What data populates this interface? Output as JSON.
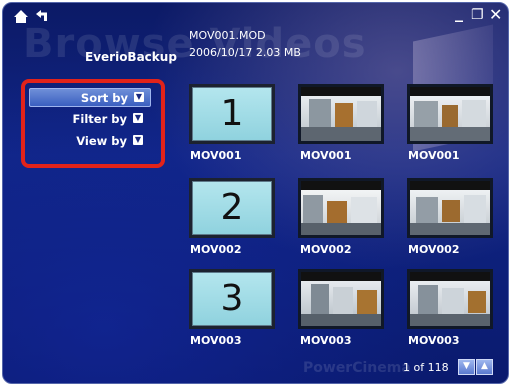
{
  "watermark": "Browse Videos",
  "header": {
    "file_name": "MOV001.MOD",
    "file_info": "2006/10/17   2.03 MB",
    "device_name": "EverioBackup"
  },
  "nav": {
    "home_icon": "home-icon",
    "back_icon": "back-arrow-icon"
  },
  "window_controls": {
    "minimize": "_",
    "restore": "❐",
    "close": "✕"
  },
  "menu": {
    "items": [
      {
        "label": "Sort by",
        "icon": "chevron-down-icon"
      },
      {
        "label": "Filter by",
        "icon": "chevron-down-icon"
      },
      {
        "label": "View by",
        "icon": "chevron-down-icon"
      }
    ],
    "highlight_color": "#e2231a"
  },
  "grid": {
    "rows": [
      {
        "number": "1",
        "items": [
          {
            "caption": "MOV001"
          },
          {
            "caption": "MOV001"
          },
          {
            "caption": "MOV001"
          }
        ]
      },
      {
        "number": "2",
        "items": [
          {
            "caption": "MOV002"
          },
          {
            "caption": "MOV002"
          },
          {
            "caption": "MOV002"
          }
        ]
      },
      {
        "number": "3",
        "items": [
          {
            "caption": "MOV003"
          },
          {
            "caption": "MOV003"
          },
          {
            "caption": "MOV003"
          }
        ]
      }
    ]
  },
  "pager": {
    "text": "1 of 118",
    "down_icon": "chevron-down-icon",
    "up_icon": "chevron-up-icon"
  },
  "brand_watermark": "PowerCinema"
}
